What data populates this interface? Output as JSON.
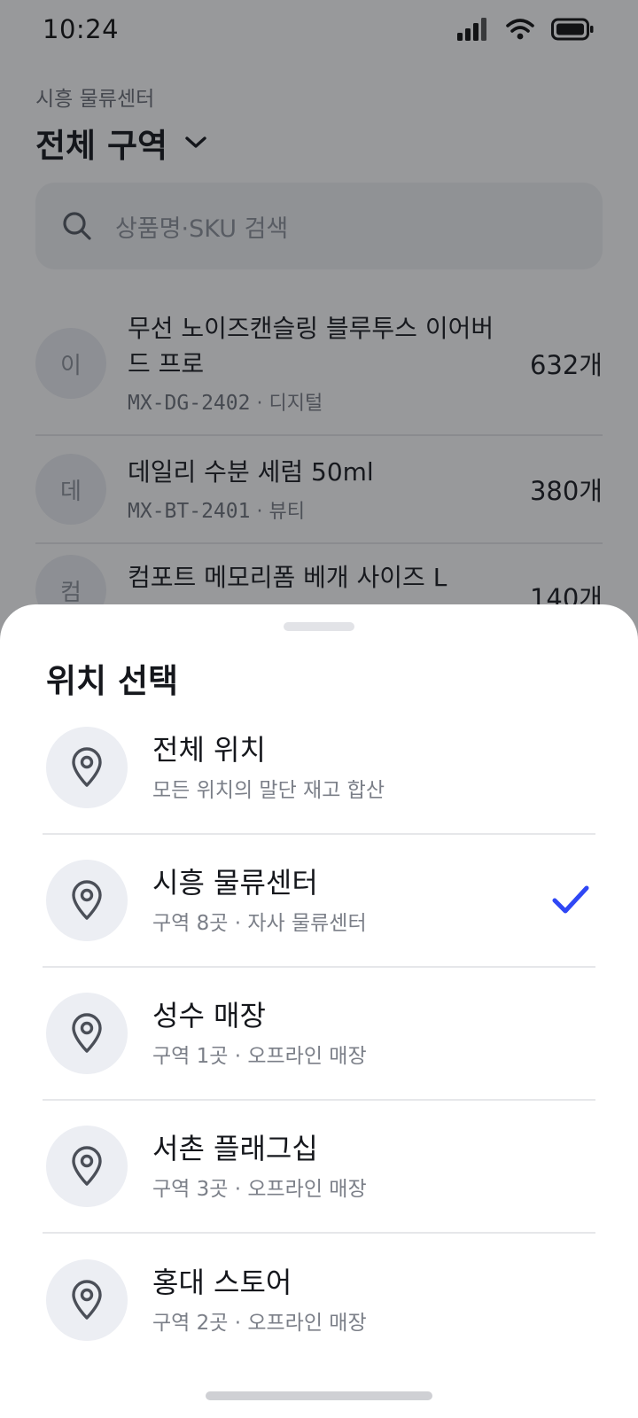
{
  "status_bar": {
    "time": "10:24"
  },
  "header": {
    "subtitle": "시흥 물류센터",
    "title": "전체 구역"
  },
  "search": {
    "placeholder": "상품명·SKU 검색"
  },
  "products": [
    {
      "initial": "이",
      "name": "무선 노이즈캔슬링 블루투스 이어버드 프로",
      "sku": "MX-DG-2402",
      "category": "디지털",
      "qty": "632개"
    },
    {
      "initial": "데",
      "name": "데일리 수분 세럼 50ml",
      "sku": "MX-BT-2401",
      "category": "뷰티",
      "qty": "380개"
    },
    {
      "initial": "컴",
      "name": "컴포트 메모리폼 베개 사이즈 L",
      "sku": "",
      "category": "",
      "qty": "140개"
    }
  ],
  "meta_separator": " · ",
  "sheet": {
    "title": "위치 선택",
    "locations": [
      {
        "name": "전체 위치",
        "desc": "모든 위치의 말단 재고 합산",
        "selected": false,
        "icon": "location-pin-icon"
      },
      {
        "name": "시흥 물류센터",
        "desc": "구역 8곳 · 자사 물류센터",
        "selected": true,
        "icon": "location-pin-icon"
      },
      {
        "name": "성수 매장",
        "desc": "구역 1곳 · 오프라인 매장",
        "selected": false,
        "icon": "location-pin-icon"
      },
      {
        "name": "서촌 플래그십",
        "desc": "구역 3곳 · 오프라인 매장",
        "selected": false,
        "icon": "location-pin-icon"
      },
      {
        "name": "홍대 스토어",
        "desc": "구역 2곳 · 오프라인 매장",
        "selected": false,
        "icon": "location-pin-icon"
      }
    ]
  },
  "colors": {
    "accent": "#2f47f5",
    "scrim": "rgba(20,22,28,0.44)",
    "icon_bg": "#eceef3"
  }
}
